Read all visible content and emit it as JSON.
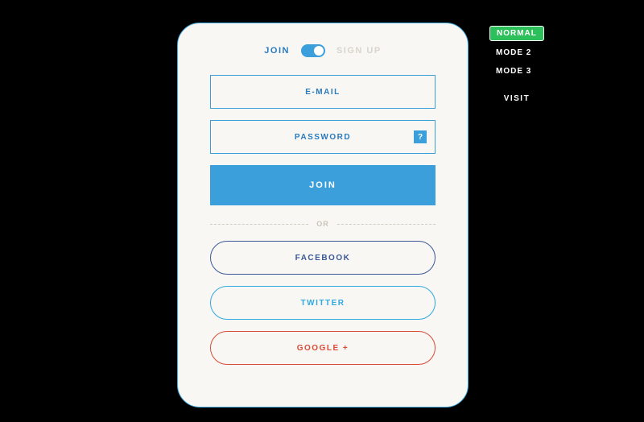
{
  "tabs": {
    "join": "JOIN",
    "signup": "SIGN UP"
  },
  "form": {
    "email_placeholder": "E-MAIL",
    "password_placeholder": "PASSWORD",
    "forgot_symbol": "?",
    "submit_label": "JOIN"
  },
  "divider": {
    "label": "OR"
  },
  "social": {
    "facebook": "FACEBOOK",
    "twitter": "TWITTER",
    "google": "GOOGLE +"
  },
  "sidebar": {
    "mode1": "Normal",
    "mode2": "Mode 2",
    "mode3": "Mode 3",
    "visit": "Visit"
  },
  "colors": {
    "accent": "#3b9fdc",
    "facebook": "#3b5998",
    "twitter": "#2fa9e0",
    "google": "#d84b37",
    "active_mode": "#2dbf5a"
  }
}
